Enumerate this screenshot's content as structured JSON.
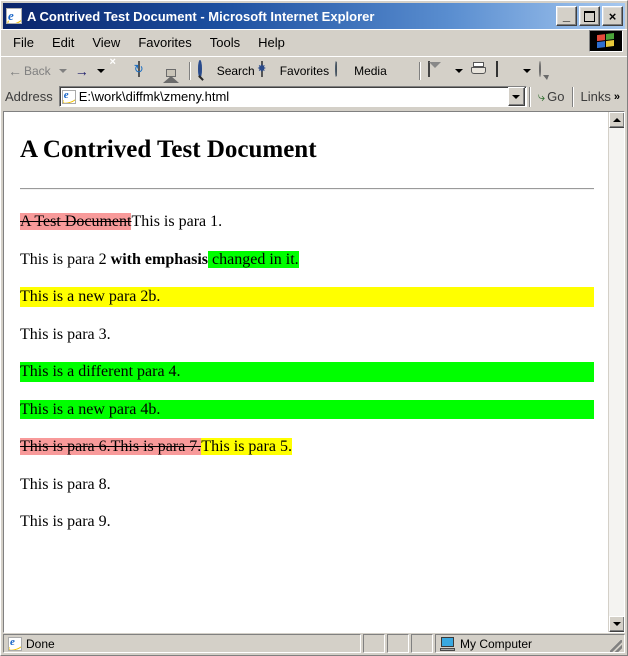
{
  "window": {
    "title": "A Contrived Test Document - Microsoft Internet Explorer",
    "icon": "ie-document-icon",
    "minimize_label": "_",
    "maximize_label": "",
    "close_label": "×"
  },
  "menubar": {
    "items": [
      {
        "label": "File"
      },
      {
        "label": "Edit"
      },
      {
        "label": "View"
      },
      {
        "label": "Favorites"
      },
      {
        "label": "Tools"
      },
      {
        "label": "Help"
      }
    ],
    "logo": "windows-flag-logo"
  },
  "toolbar": {
    "back_label": "Back",
    "forward_label": "",
    "stop_label": "",
    "refresh_label": "",
    "home_label": "",
    "search_label": "Search",
    "favorites_label": "Favorites",
    "media_label": "Media",
    "history_label": "",
    "mail_label": "",
    "print_label": "",
    "edit_label": "",
    "discuss_label": ""
  },
  "address_bar": {
    "label": "Address",
    "value": "E:\\work\\diffmk\\zmeny.html",
    "placeholder": "",
    "go_label": "Go",
    "go_icon": "go-arrow-icon",
    "links_label": "Links",
    "overflow_label": "»"
  },
  "document": {
    "heading": "A Contrived Test Document",
    "paragraphs": [
      {
        "id": "para-1",
        "runs": [
          {
            "text": "A Test Document",
            "style": "del"
          },
          {
            "text": "This is para 1.",
            "style": "plain"
          }
        ]
      },
      {
        "id": "para-2",
        "runs": [
          {
            "text": "This is para 2 ",
            "style": "plain"
          },
          {
            "text": "with emphasis",
            "style": "bold"
          },
          {
            "text": " changed in it.",
            "style": "ins-green"
          }
        ]
      },
      {
        "id": "para-2b",
        "block": "yellow",
        "runs": [
          {
            "text": "This is a new para 2b.",
            "style": "plain"
          }
        ]
      },
      {
        "id": "para-3",
        "runs": [
          {
            "text": "This is para 3.",
            "style": "plain"
          }
        ]
      },
      {
        "id": "para-4",
        "block": "green",
        "runs": [
          {
            "text": "This is a different para 4.",
            "style": "plain"
          }
        ]
      },
      {
        "id": "para-4b",
        "block": "green",
        "runs": [
          {
            "text": "This is a new para 4b.",
            "style": "plain"
          }
        ]
      },
      {
        "id": "para-6-7-5",
        "runs": [
          {
            "text": "This is para 6.This is para 7.",
            "style": "del"
          },
          {
            "text": "This is para 5.",
            "style": "ins-yellow"
          }
        ]
      },
      {
        "id": "para-8",
        "runs": [
          {
            "text": "This is para 8.",
            "style": "plain"
          }
        ]
      },
      {
        "id": "para-9",
        "runs": [
          {
            "text": "This is para 9.",
            "style": "plain"
          }
        ]
      }
    ]
  },
  "statusbar": {
    "status_text": "Done",
    "zone_text": "My Computer",
    "zone_icon": "computer-icon",
    "status_icon": "ie-document-icon"
  },
  "colors": {
    "deleted": "#f89a9a",
    "inserted_green": "#00ff00",
    "inserted_yellow": "#ffff00",
    "title_bar_start": "#0a246a",
    "title_bar_end": "#a6c8f0",
    "chrome": "#d4d0c8"
  }
}
